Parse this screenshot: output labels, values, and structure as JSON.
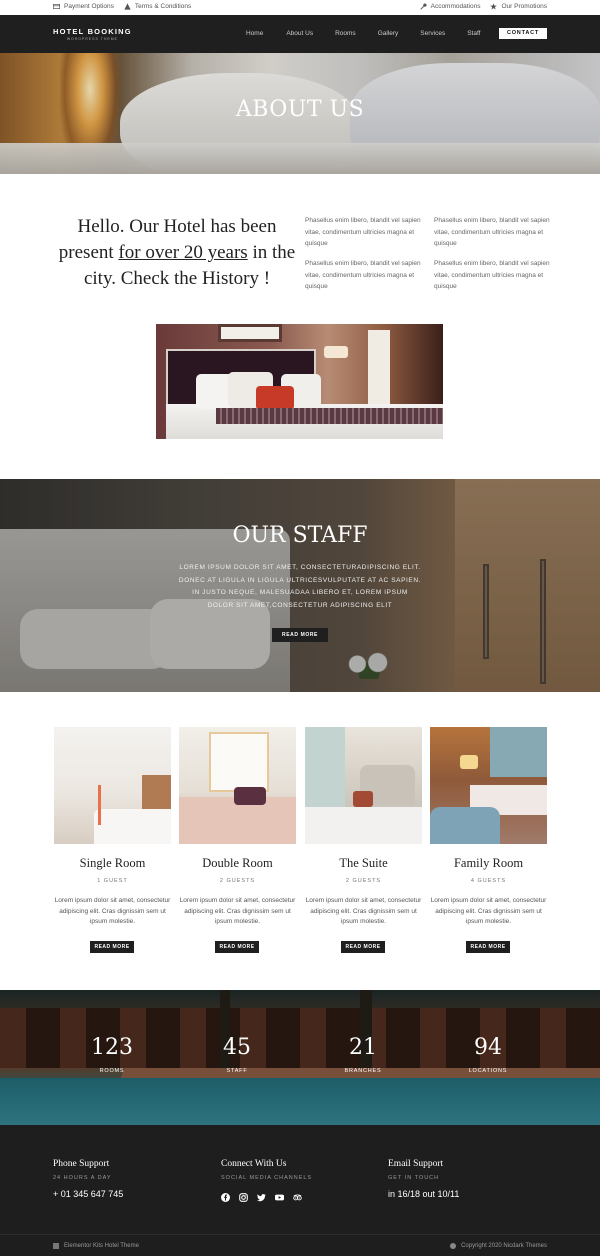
{
  "topbar": {
    "left": [
      {
        "label": "Payment Options",
        "icon": "card-icon"
      },
      {
        "label": "Terms & Conditions",
        "icon": "warning-icon"
      }
    ],
    "right": [
      {
        "label": "Accommodations",
        "icon": "key-icon"
      },
      {
        "label": "Our Promotions",
        "icon": "star-icon"
      }
    ]
  },
  "nav": {
    "logo_main": "HOTEL BOOKING",
    "logo_sub": "WORDPRESS THEME",
    "links": [
      "Home",
      "About Us",
      "Rooms",
      "Gallery",
      "Services",
      "Staff"
    ],
    "contact": "CONTACT"
  },
  "hero": {
    "title": "ABOUT US"
  },
  "intro": {
    "text_before": "Hello. Our Hotel has been present ",
    "text_link": "for over 20 years",
    "text_after": " in the city. Check the History !",
    "paragraphs": [
      "Phasellus enim libero, blandit vel sapien vitae, condimentum ultricies magna et quisque",
      "Phasellus enim libero, blandit vel sapien vitae, condimentum ultricies magna et quisque",
      "Phasellus enim libero, blandit vel sapien vitae, condimentum ultricies magna et quisque",
      "Phasellus enim libero, blandit vel sapien vitae, condimentum ultricies magna et quisque"
    ]
  },
  "staff": {
    "title": "OUR STAFF",
    "body": "Lorem ipsum dolor sit amet, consecteturadipiscing elit. Donec at ligula in ligula ultricesvulputate at ac sapien. In justo neque, malesuadaa libero et, lorem ipsum dolor sit amet,consectetur adipiscing elit",
    "button": "READ MORE"
  },
  "rooms": [
    {
      "name": "Single Room",
      "guests": "1 GUEST",
      "desc": "Lorem ipsum dolor sit amet, consectetur adipiscing elit. Cras dignissim sem ut ipsum molestie.",
      "button": "READ MORE"
    },
    {
      "name": "Double Room",
      "guests": "2 GUESTS",
      "desc": "Lorem ipsum dolor sit amet, consectetur adipiscing elit. Cras dignissim sem ut ipsum molestie.",
      "button": "READ MORE"
    },
    {
      "name": "The Suite",
      "guests": "2 GUESTS",
      "desc": "Lorem ipsum dolor sit amet, consectetur adipiscing elit. Cras dignissim sem ut ipsum molestie.",
      "button": "READ MORE"
    },
    {
      "name": "Family Room",
      "guests": "4 GUESTS",
      "desc": "Lorem ipsum dolor sit amet, consectetur adipiscing elit. Cras dignissim sem ut ipsum molestie.",
      "button": "READ MORE"
    }
  ],
  "stats": [
    {
      "number": "123",
      "label": "ROOMS"
    },
    {
      "number": "45",
      "label": "STAFF"
    },
    {
      "number": "21",
      "label": "BRANCHES"
    },
    {
      "number": "94",
      "label": "LOCATIONS"
    }
  ],
  "footer": {
    "phone": {
      "title": "Phone Support",
      "sub": "24 HOURS A DAY",
      "value": "+ 01 345 647 745"
    },
    "connect": {
      "title": "Connect With Us",
      "sub": "SOCIAL MEDIA CHANNELS",
      "icons": [
        "facebook-icon",
        "instagram-icon",
        "twitter-icon",
        "youtube-icon",
        "tripadvisor-icon"
      ]
    },
    "email": {
      "title": "Email Support",
      "sub": "GET IN TOUCH",
      "value": "in 16/18 out 10/11"
    }
  },
  "bottom": {
    "left": "Elementor Kits Hotel Theme",
    "right": "Copyright 2020 Nicdark Themes"
  },
  "colors": {
    "dark": "#1f1f1f",
    "white": "#ffffff",
    "text": "#222222",
    "muted": "#666666"
  }
}
